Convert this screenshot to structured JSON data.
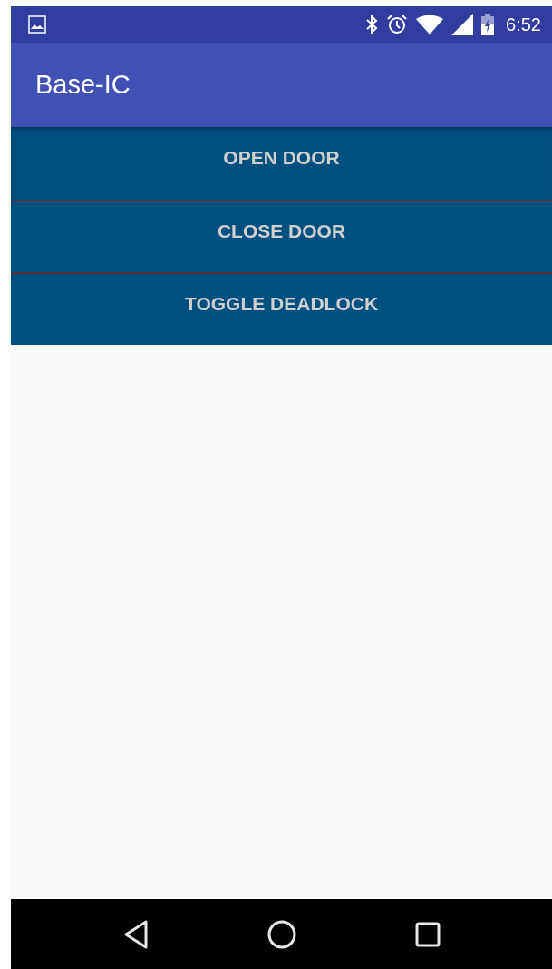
{
  "status_bar": {
    "time": "6:52"
  },
  "app_bar": {
    "title": "Base-IC"
  },
  "buttons": [
    "OPEN DOOR",
    "CLOSE DOOR",
    "TOGGLE DEADLOCK"
  ]
}
